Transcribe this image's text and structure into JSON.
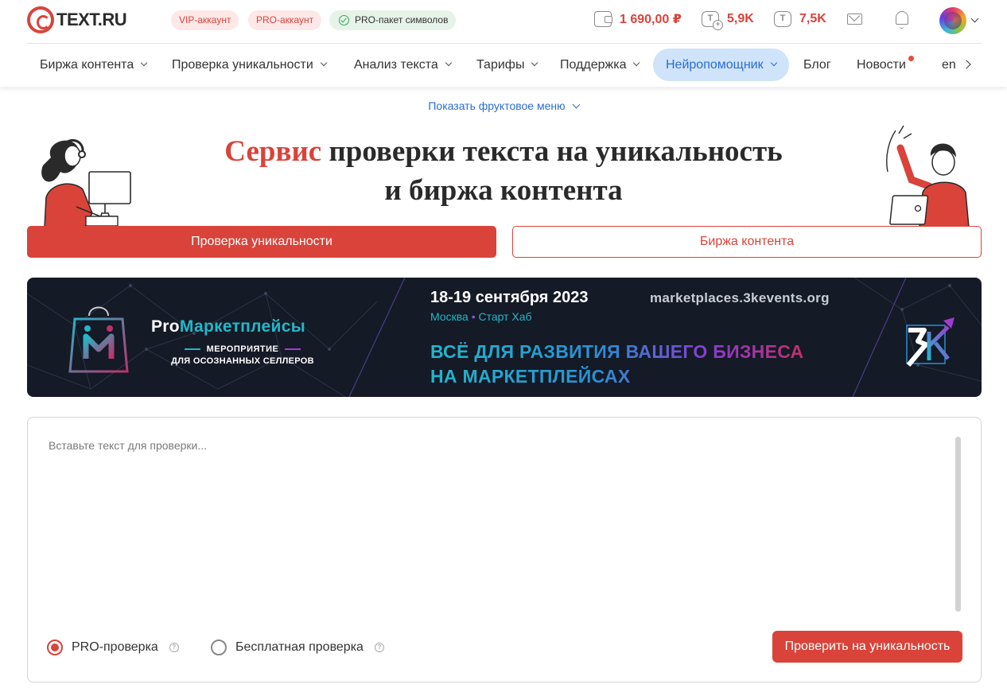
{
  "header": {
    "logo_text": "TEXT.RU",
    "badges": {
      "vip": "VIP-аккаунт",
      "pro": "PRO-аккаунт",
      "pack": "PRO-пакет символов"
    },
    "stats": {
      "balance": "1 690,00 ₽",
      "symbols_pro": "5,9K",
      "symbols": "7,5K"
    },
    "icons": [
      "wallet-icon",
      "text-plus-icon",
      "text-icon",
      "mail-icon",
      "bell-icon",
      "chevron-down-icon"
    ]
  },
  "nav": {
    "items": [
      {
        "label": "Биржа контента"
      },
      {
        "label": "Проверка уникальности"
      },
      {
        "label": "Анализ текста"
      },
      {
        "label": "Тарифы"
      },
      {
        "label": "Поддержка"
      },
      {
        "label": "Нейропомощник"
      },
      {
        "label": "Блог"
      },
      {
        "label": "Новости"
      },
      {
        "label": "en"
      }
    ]
  },
  "hero": {
    "fruit_menu": "Показать фруктовое меню",
    "title_accent": "Сервис",
    "title_rest": "проверки текста на уникальность",
    "title_line2": "и биржа контента",
    "btn_check": "Проверка уникальности",
    "btn_exchange": "Биржа контента"
  },
  "banner": {
    "brand_pro": "Pro",
    "brand_rest": "Маркетплейсы",
    "sub1": "МЕРОПРИЯТИЕ",
    "sub2": "ДЛЯ ОСОЗНАННЫХ СЕЛЛЕРОВ",
    "date": "18-19 сентября 2023",
    "city": "Москва",
    "bullet": "•",
    "venue": "Старт Хаб",
    "url": "marketplaces.3kevents.org",
    "headline1": "ВСЁ ДЛЯ РАЗВИТИЯ ВАШЕГО БИЗНЕСА",
    "headline2": "НА МАРКЕТПЛЕЙСАХ"
  },
  "editor": {
    "placeholder": "Вставьте текст для проверки...",
    "value": "",
    "radio_pro": "PRO-проверка",
    "radio_free": "Бесплатная проверка",
    "help_glyph": "?",
    "selected": "pro",
    "submit": "Проверить на уникальность"
  },
  "colors": {
    "brand_red": "#d9433a",
    "link_blue": "#2b6dd0",
    "active_nav_bg": "#cfe3fa",
    "banner_bg": "#141a26"
  }
}
